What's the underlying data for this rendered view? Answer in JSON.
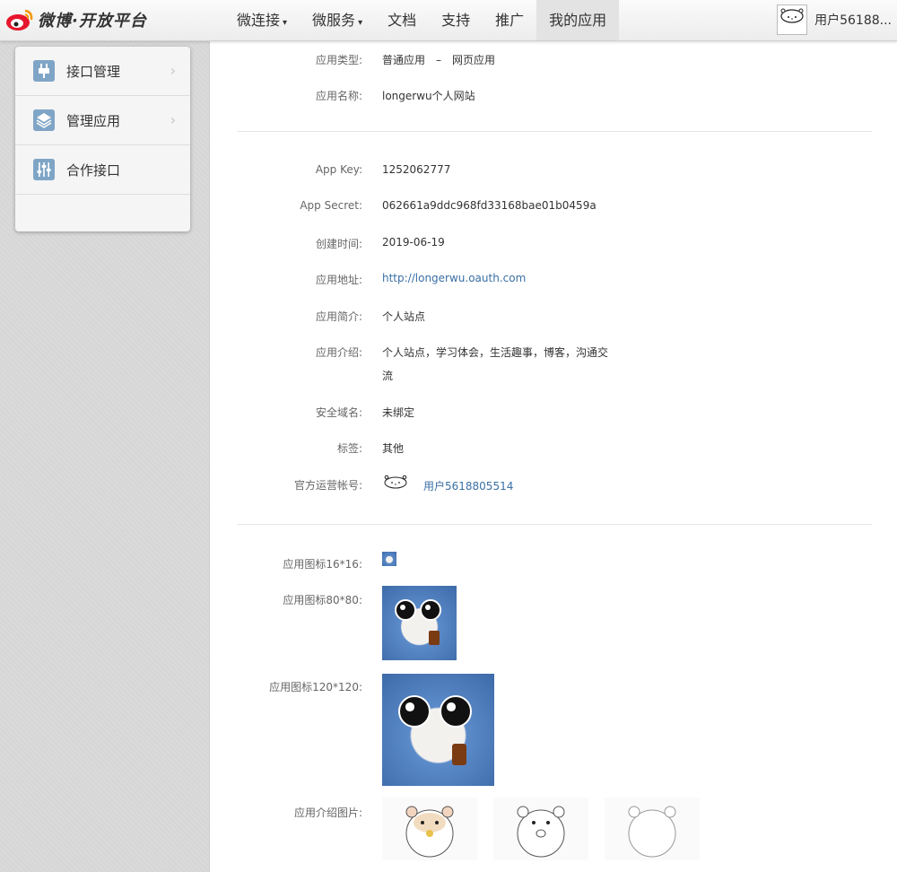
{
  "header": {
    "logo_text": "微博·开放平台",
    "nav": [
      {
        "label": "微连接",
        "caret": "▾"
      },
      {
        "label": "微服务",
        "caret": "▾"
      },
      {
        "label": "文档",
        "caret": ""
      },
      {
        "label": "支持",
        "caret": ""
      },
      {
        "label": "推广",
        "caret": ""
      },
      {
        "label": "我的应用",
        "caret": ""
      }
    ],
    "user_name": "用户56188..."
  },
  "sidebar": {
    "items": [
      {
        "label": "接口管理",
        "icon": "plug-icon",
        "arrow": "›"
      },
      {
        "label": "管理应用",
        "icon": "layers-icon",
        "arrow": "›"
      },
      {
        "label": "合作接口",
        "icon": "sliders-icon",
        "arrow": ""
      }
    ]
  },
  "app": {
    "type_label": "应用类型:",
    "type_value": "普通应用　–　网页应用",
    "name_label": "应用名称:",
    "name_value": "longerwu个人网站",
    "key_label": "App Key:",
    "key_value": "1252062777",
    "secret_label": "App Secret:",
    "secret_value": "062661a9ddc968fd33168bae01b0459a",
    "created_label": "创建时间:",
    "created_value": "2019-06-19",
    "url_label": "应用地址:",
    "url_value": "http://longerwu.oauth.com",
    "brief_label": "应用简介:",
    "brief_value": "个人站点",
    "intro_label": "应用介绍:",
    "intro_value_line1": "个人站点，学习体会，生活趣事，博客，沟通交",
    "intro_value_line2": "流",
    "domain_label": "安全域名:",
    "domain_value": "未绑定",
    "tag_label": "标签:",
    "tag_value": "其他",
    "official_label": "官方运营帐号:",
    "official_value": "用户5618805514",
    "icon16_label": "应用图标16*16:",
    "icon80_label": "应用图标80*80:",
    "icon120_label": "应用图标120*120:",
    "intro_images_label": "应用介绍图片:"
  },
  "colors": {
    "link": "#3a6fa5",
    "sidebar_icon": "#7fa5c6",
    "nav_active_bg": "#e3e3e3"
  }
}
